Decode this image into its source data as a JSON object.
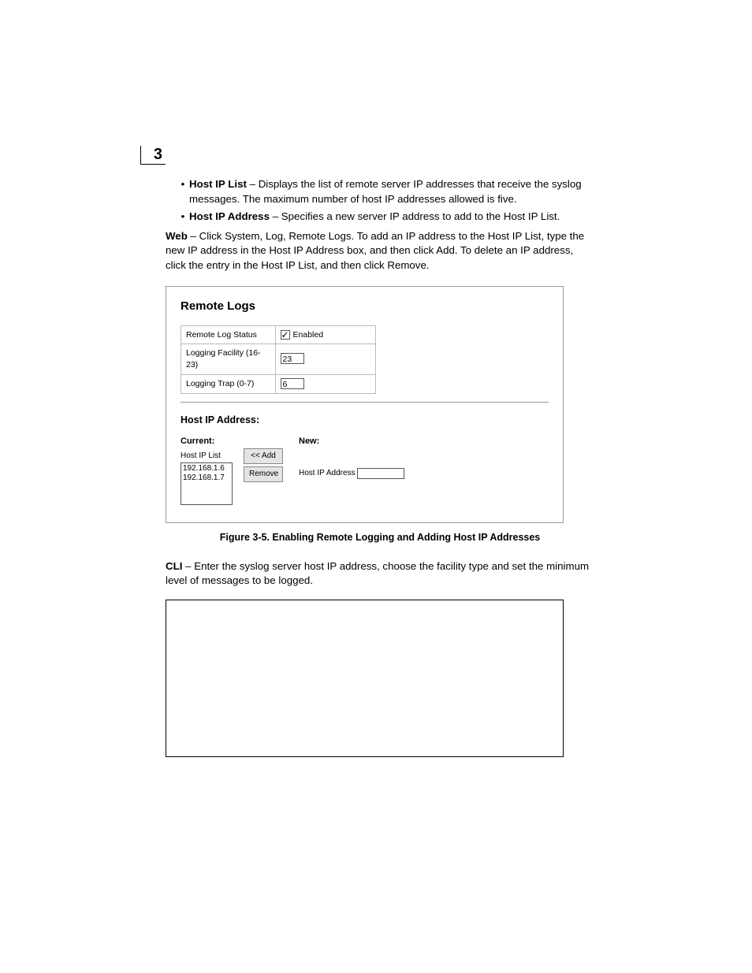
{
  "chapter_number": "3",
  "bullets": [
    {
      "term": "Host IP List",
      "desc": " – Displays the list of remote server IP addresses that receive the syslog messages. The maximum number of host IP addresses allowed is five."
    },
    {
      "term": "Host IP Address",
      "desc": " – Specifies a new server IP address to add to the Host IP List."
    }
  ],
  "web_label": "Web",
  "web_text": " – Click System, Log, Remote Logs. To add an IP address to the Host IP List, type the new IP address in the Host IP Address box, and then click Add. To delete an IP address, click the entry in the Host IP List, and then click Remove.",
  "figure": {
    "title": "Remote Logs",
    "rows": {
      "status_label": "Remote Log Status",
      "status_value": "Enabled",
      "facility_label": "Logging Facility (16-23)",
      "facility_value": "23",
      "trap_label": "Logging Trap (0-7)",
      "trap_value": "6"
    },
    "host_section_label": "Host IP Address:",
    "current_label": "Current:",
    "new_label": "New:",
    "list_label": "Host IP List",
    "list_items": [
      "192.168.1.6",
      "192.168.1.7"
    ],
    "btn_add": "<< Add",
    "btn_remove": "Remove",
    "ip_field_label": "Host IP Address"
  },
  "figure_caption": "Figure 3-5.   Enabling Remote Logging and Adding Host IP Addresses",
  "cli_label": "CLI",
  "cli_text": " – Enter the syslog server host IP address, choose the facility type and set the minimum level of messages to be logged."
}
